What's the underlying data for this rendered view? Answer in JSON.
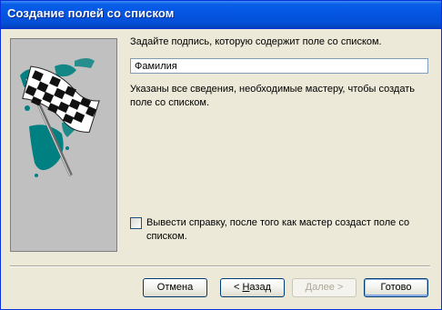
{
  "window": {
    "title": "Создание полей со списком"
  },
  "wizard": {
    "prompt": "Задайте подпись, которую содержит поле со списком.",
    "label_value": "Фамилия",
    "info": "Указаны все сведения, необходимые мастеру, чтобы создать поле со списком.",
    "help_checkbox": {
      "label": "Вывести справку, после того как мастер создаст поле со списком.",
      "checked": false
    }
  },
  "buttons": {
    "cancel": "Отмена",
    "back_prefix": "< ",
    "back_hotkey": "Н",
    "back_rest": "азад",
    "next": "Далее >",
    "finish": "Готово"
  },
  "colors": {
    "titlebar": "#0454e0",
    "face": "#ece9d8",
    "flag_teal": "#008080",
    "panel_gray": "#c0c0c0"
  }
}
